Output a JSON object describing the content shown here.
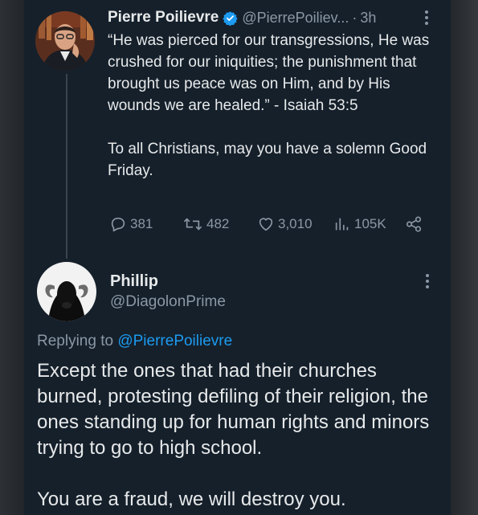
{
  "tweet": {
    "author_name": "Pierre Poilievre",
    "author_handle": "@PierrePoiliev...",
    "separator": "·",
    "time": "3h",
    "paragraphs": [
      "“He was pierced for our transgressions, He was crushed for our iniquities; the punishment that brought us peace was on Him, and by His wounds we are healed.” - Isaiah 53:5",
      "To all Christians, may you have a solemn Good Friday."
    ],
    "stats": {
      "replies": "381",
      "reposts": "482",
      "likes": "3,010",
      "views": "105K"
    },
    "icons": [
      "verified-badge-icon",
      "more-icon",
      "reply-icon",
      "repost-icon",
      "like-icon",
      "views-icon",
      "share-icon"
    ]
  },
  "reply": {
    "author_name": "Phillip",
    "author_handle": "@DiagolonPrime",
    "replying_prefix": "Replying to",
    "replying_mention": "@PierrePoilievre",
    "paragraphs": [
      "Except the ones that had their churches burned, protesting defiling of their religion, the ones standing up for human rights and minors trying to go to high school.",
      "You are a fraud, we will destroy you."
    ]
  },
  "colors": {
    "background": "#15202b",
    "text": "#e7e9ea",
    "muted": "#8b98a5",
    "accent": "#1d9bf0"
  }
}
